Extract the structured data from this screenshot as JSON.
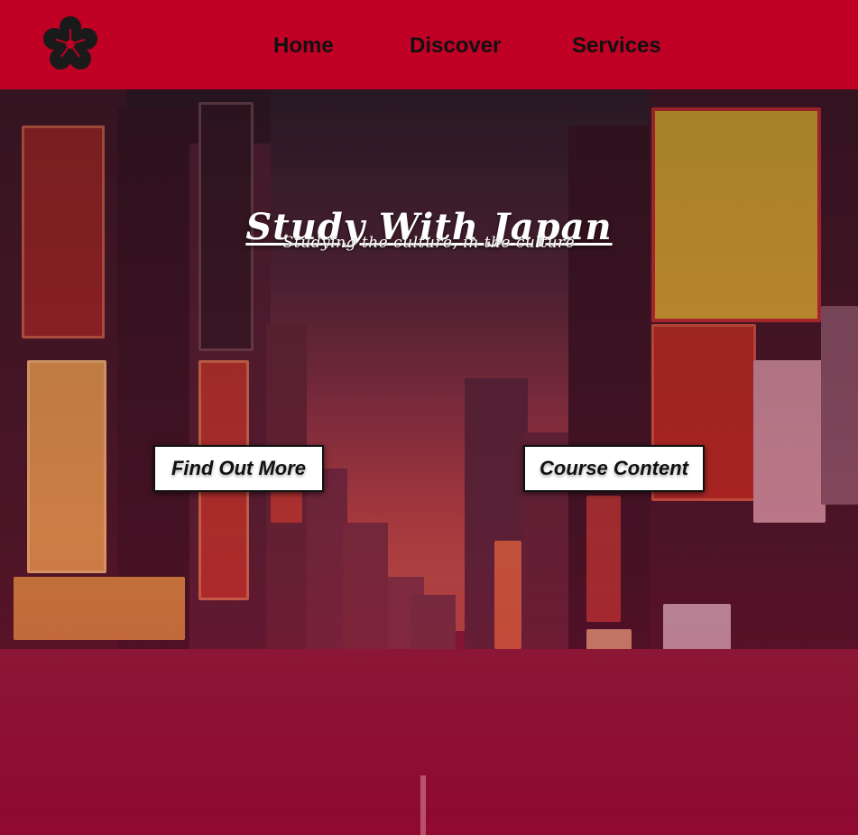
{
  "header": {
    "logo_icon": "flower-crest-icon",
    "nav": [
      {
        "label": "Home"
      },
      {
        "label": "Discover"
      },
      {
        "label": "Services"
      }
    ]
  },
  "hero": {
    "title": "Study With Japan",
    "subtitle": "Studying the culture, in the culture",
    "buttons": {
      "find_out_more": "Find Out More",
      "course_content": "Course Content"
    }
  },
  "colors": {
    "header_bg": "#c00024",
    "overlay_tint": "#a00032",
    "button_bg": "#ffffff"
  }
}
